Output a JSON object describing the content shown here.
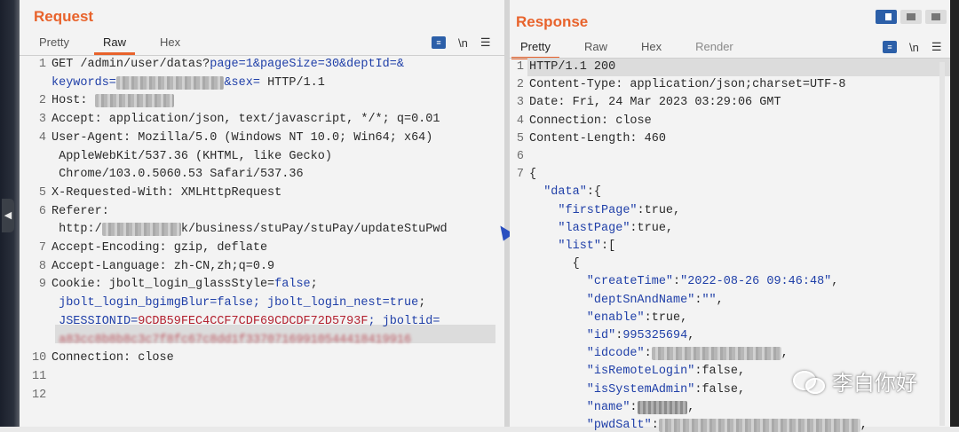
{
  "request": {
    "title": "Request",
    "tabs": [
      "Pretty",
      "Raw",
      "Hex"
    ],
    "active_tab": "Raw",
    "tool_wrap": "≡",
    "tool_newline": "\\n",
    "tool_menu": "☰",
    "lines": [
      {
        "n": "1",
        "segs": [
          {
            "t": "GET /admin/user/datas?"
          },
          {
            "t": "page=1&pageSize=30&deptId=&",
            "c": "blue"
          }
        ]
      },
      {
        "n": "",
        "segs": [
          {
            "t": "keywords=",
            "c": "blue"
          },
          {
            "t": "xxxxxxxxxxxxxxx",
            "c": "blur"
          },
          {
            "t": "&sex=",
            "c": "blue"
          },
          {
            "t": " HTTP/1.1"
          }
        ]
      },
      {
        "n": "2",
        "segs": [
          {
            "t": "Host: "
          },
          {
            "t": "xxxxxxxxxxx",
            "c": "blur"
          }
        ]
      },
      {
        "n": "3",
        "segs": [
          {
            "t": "Accept: application/json, text/javascript, */*; q=0.01"
          }
        ]
      },
      {
        "n": "4",
        "segs": [
          {
            "t": "User-Agent: Mozilla/5.0 (Windows NT 10.0; Win64; x64)"
          }
        ]
      },
      {
        "n": "",
        "segs": [
          {
            "t": " AppleWebKit/537.36 (KHTML, like Gecko)"
          }
        ]
      },
      {
        "n": "",
        "segs": [
          {
            "t": " Chrome/103.0.5060.53 Safari/537.36"
          }
        ]
      },
      {
        "n": "5",
        "segs": [
          {
            "t": "X-Requested-With: XMLHttpRequest"
          }
        ]
      },
      {
        "n": "6",
        "segs": [
          {
            "t": "Referer:"
          }
        ]
      },
      {
        "n": "",
        "segs": [
          {
            "t": " http:/"
          },
          {
            "t": "xxxxxxxxxxx",
            "c": "blur"
          },
          {
            "t": "k/business/stuPay/stuPay/updateStuPwd"
          }
        ]
      },
      {
        "n": "7",
        "segs": [
          {
            "t": "Accept-Encoding: gzip, deflate"
          }
        ]
      },
      {
        "n": "8",
        "segs": [
          {
            "t": "Accept-Language: zh-CN,zh;q=0.9"
          }
        ]
      },
      {
        "n": "9",
        "segs": [
          {
            "t": "Cookie: jbolt_login_glassStyle="
          },
          {
            "t": "false",
            "c": "blue"
          },
          {
            "t": ";"
          }
        ]
      },
      {
        "n": "",
        "segs": [
          {
            "t": " jbolt_login_bgimgBlur=",
            "c": "blue"
          },
          {
            "t": "false",
            "c": "blue"
          },
          {
            "t": "; jbolt_login_nest=",
            "c": "blue"
          },
          {
            "t": "true",
            "c": "blue"
          },
          {
            "t": ";"
          }
        ]
      },
      {
        "n": "",
        "segs": [
          {
            "t": " JSESSIONID=",
            "c": "blue"
          },
          {
            "t": "9CDB59FEC4CCF7CDF69CDCDF72D5793F",
            "c": "red"
          },
          {
            "t": "; jboltid=",
            "c": "blue"
          }
        ]
      },
      {
        "n": "",
        "segs": [
          {
            "t": " a83cc8b8b8c3c7f8fc67c8dd1f33707169910544418419916",
            "c": "red"
          }
        ],
        "blurred": true
      },
      {
        "n": "10",
        "segs": [
          {
            "t": "Connection: close"
          }
        ]
      },
      {
        "n": "11",
        "segs": [
          {
            "t": ""
          }
        ]
      },
      {
        "n": "12",
        "segs": [
          {
            "t": ""
          }
        ]
      }
    ]
  },
  "response": {
    "title": "Response",
    "tabs": [
      "Pretty",
      "Raw",
      "Hex",
      "Render"
    ],
    "active_tab": "Pretty",
    "tool_wrap": "≡",
    "tool_newline": "\\n",
    "tool_menu": "☰",
    "lines": [
      {
        "n": "1",
        "segs": [
          {
            "t": "HTTP/1.1 200"
          }
        ]
      },
      {
        "n": "2",
        "segs": [
          {
            "t": "Content-Type: application/json;charset=UTF-8"
          }
        ]
      },
      {
        "n": "3",
        "segs": [
          {
            "t": "Date: Fri, 24 Mar 2023 03:29:06 GMT"
          }
        ]
      },
      {
        "n": "4",
        "segs": [
          {
            "t": "Connection: close"
          }
        ]
      },
      {
        "n": "5",
        "segs": [
          {
            "t": "Content-Length: 460"
          }
        ]
      },
      {
        "n": "6",
        "segs": [
          {
            "t": ""
          }
        ]
      },
      {
        "n": "7",
        "segs": [
          {
            "t": "{"
          }
        ]
      },
      {
        "n": "",
        "segs": [
          {
            "t": "  \"data\"",
            "c": "blue"
          },
          {
            "t": ":{"
          }
        ]
      },
      {
        "n": "",
        "segs": [
          {
            "t": "    \"firstPage\"",
            "c": "blue"
          },
          {
            "t": ":true,"
          }
        ]
      },
      {
        "n": "",
        "segs": [
          {
            "t": "    \"lastPage\"",
            "c": "blue"
          },
          {
            "t": ":true,"
          }
        ]
      },
      {
        "n": "",
        "segs": [
          {
            "t": "    \"list\"",
            "c": "blue"
          },
          {
            "t": ":["
          }
        ]
      },
      {
        "n": "",
        "segs": [
          {
            "t": "      {"
          }
        ]
      },
      {
        "n": "",
        "segs": [
          {
            "t": "        \"createTime\"",
            "c": "blue"
          },
          {
            "t": ":"
          },
          {
            "t": "\"2022-08-26 09:46:48\"",
            "c": "blue"
          },
          {
            "t": ","
          }
        ]
      },
      {
        "n": "",
        "segs": [
          {
            "t": "        \"deptSnAndName\"",
            "c": "blue"
          },
          {
            "t": ":"
          },
          {
            "t": "\"\"",
            "c": "blue"
          },
          {
            "t": ","
          }
        ]
      },
      {
        "n": "",
        "segs": [
          {
            "t": "        \"enable\"",
            "c": "blue"
          },
          {
            "t": ":true,"
          }
        ]
      },
      {
        "n": "",
        "segs": [
          {
            "t": "        \"id\"",
            "c": "blue"
          },
          {
            "t": ":"
          },
          {
            "t": "995325694",
            "c": "blue"
          },
          {
            "t": ","
          }
        ]
      },
      {
        "n": "",
        "segs": [
          {
            "t": "        \"idcode\"",
            "c": "blue"
          },
          {
            "t": ":"
          },
          {
            "t": "\"xxxxxxxxxxxxxxxx\"",
            "c": "blur"
          },
          {
            "t": ","
          }
        ]
      },
      {
        "n": "",
        "segs": [
          {
            "t": "        \"isRemoteLogin\"",
            "c": "blue"
          },
          {
            "t": ":false,"
          }
        ]
      },
      {
        "n": "",
        "segs": [
          {
            "t": "        \"isSystemAdmin\"",
            "c": "blue"
          },
          {
            "t": ":false,"
          }
        ]
      },
      {
        "n": "",
        "segs": [
          {
            "t": "        \"name\"",
            "c": "blue"
          },
          {
            "t": ":"
          },
          {
            "t": "\"xxxxx\"",
            "c": "blurdark"
          },
          {
            "t": ","
          }
        ]
      },
      {
        "n": "",
        "segs": [
          {
            "t": "        \"pwdSalt\"",
            "c": "blue"
          },
          {
            "t": ":"
          },
          {
            "t": "\"xxxxxxxxxxxxxxxxxxxxxxxxxx\"",
            "c": "blur"
          },
          {
            "t": ","
          }
        ]
      }
    ]
  },
  "watermark": {
    "text": "李白你好",
    "icon": "wechat-icon"
  }
}
